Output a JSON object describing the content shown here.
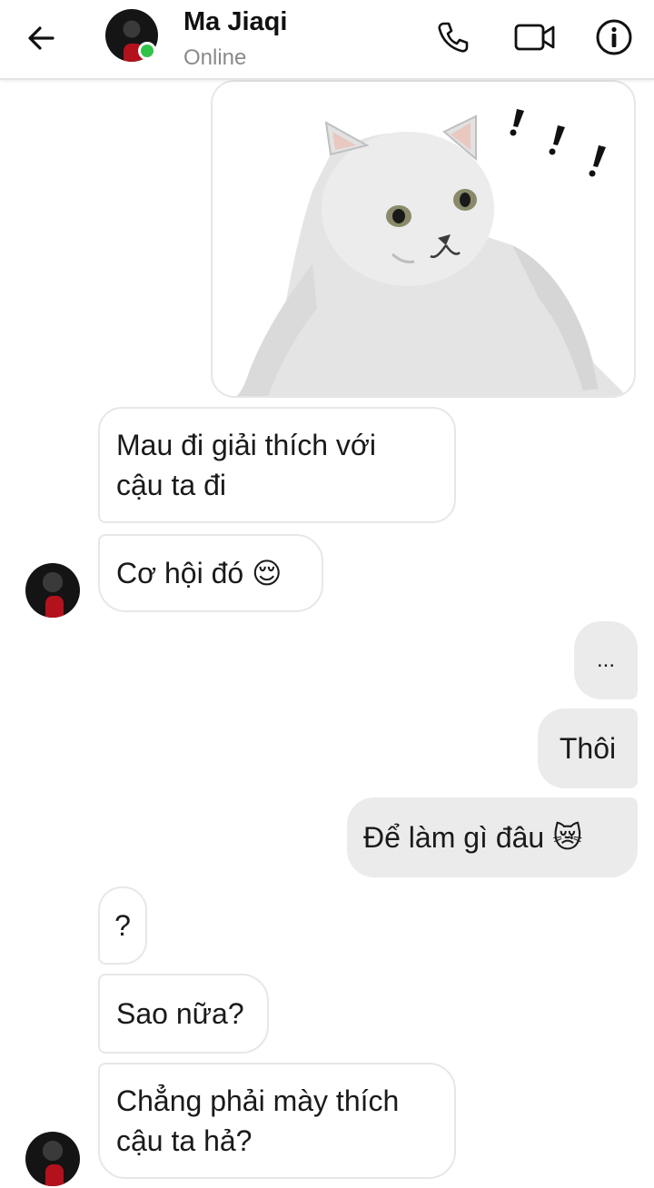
{
  "header": {
    "contact_name": "Ma Jiaqi",
    "status": "Online"
  },
  "messages": [
    {
      "id": "m1",
      "side": "in",
      "text": "Mau đi giải thích với",
      "text2": "cậu ta đi"
    },
    {
      "id": "m2",
      "side": "in",
      "text": "Cơ hội đó 😌"
    },
    {
      "id": "m3",
      "side": "out",
      "text": "..."
    },
    {
      "id": "m4",
      "side": "out",
      "text": "Thôi"
    },
    {
      "id": "m5",
      "side": "out",
      "text": "Để làm gì đâu 😿"
    },
    {
      "id": "m6",
      "side": "in",
      "text": "?"
    },
    {
      "id": "m7",
      "side": "in",
      "text": "Sao nữa?"
    },
    {
      "id": "m8",
      "side": "in",
      "text": "Chẳng phải mày thích",
      "text2": "cậu ta hả?"
    }
  ],
  "sticker": {
    "exclaim": "! ! !"
  },
  "colors": {
    "online": "#31c24a",
    "out_bubble": "#ebebeb",
    "in_border": "#e7e7e7"
  }
}
